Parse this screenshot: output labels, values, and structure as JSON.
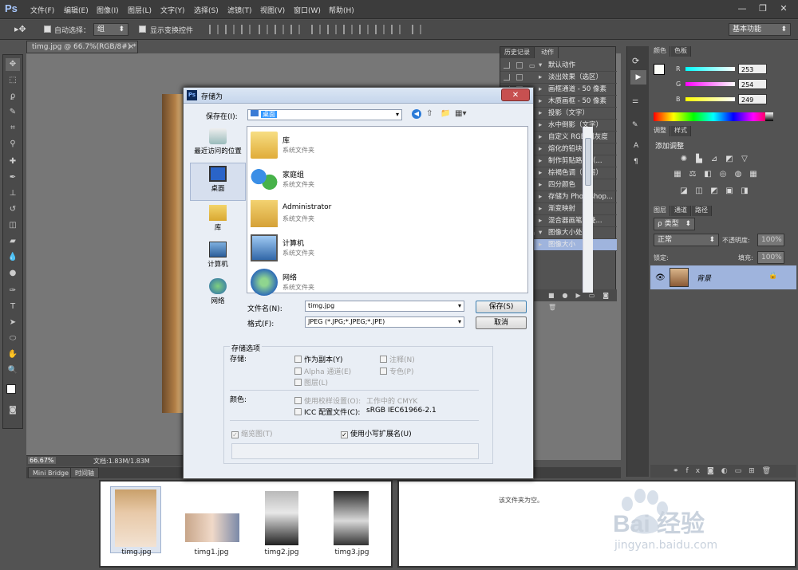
{
  "app": {
    "logo": "Ps"
  },
  "menus": [
    "文件(F)",
    "编辑(E)",
    "图像(I)",
    "图层(L)",
    "文字(Y)",
    "选择(S)",
    "滤镜(T)",
    "视图(V)",
    "窗口(W)",
    "帮助(H)"
  ],
  "options": {
    "auto_select_label": "自动选择：",
    "auto_select_value": "组",
    "show_transform_label": "显示变换控件",
    "workspace": "基本功能"
  },
  "document": {
    "tab_title": "timg.jpg @ 66.7%(RGB/8#) *",
    "zoom": "66.67%",
    "doc_size": "文档:1.83M/1.83M",
    "bottom_tabs": [
      "Mini Bridge",
      "时间轴"
    ]
  },
  "history_panel": {
    "tabs": [
      "历史记录",
      "动作"
    ],
    "actions": [
      {
        "label": "默认动作",
        "level": 0
      },
      {
        "label": "淡出效果（选区）",
        "level": 1
      },
      {
        "label": "画框通道 - 50 像素",
        "level": 1
      },
      {
        "label": "木质画框 - 50 像素",
        "level": 1
      },
      {
        "label": "投影（文字）",
        "level": 1
      },
      {
        "label": "水中倒影（文字）",
        "level": 1
      },
      {
        "label": "自定义 RGB 到灰度",
        "level": 1
      },
      {
        "label": "熔化的铅块",
        "level": 1
      },
      {
        "label": "制作剪贴路径（...",
        "level": 1
      },
      {
        "label": "棕褐色调（图层）",
        "level": 1
      },
      {
        "label": "四分颜色",
        "level": 1
      },
      {
        "label": "存储为 Photoshop...",
        "level": 1
      },
      {
        "label": "渐变映射",
        "level": 1
      },
      {
        "label": "混合器画笔克隆...",
        "level": 1
      },
      {
        "label": "图像大小处理",
        "level": 0
      },
      {
        "label": "图像大小",
        "level": 1
      }
    ]
  },
  "color_panel": {
    "tabs": [
      "颜色",
      "色板"
    ],
    "channels": [
      {
        "name": "R",
        "value": "253"
      },
      {
        "name": "G",
        "value": "254"
      },
      {
        "name": "B",
        "value": "249"
      }
    ]
  },
  "adjust_panel": {
    "tabs": [
      "调整",
      "样式"
    ],
    "title": "添加调整"
  },
  "layers_panel": {
    "tabs": [
      "图层",
      "通道",
      "路径"
    ],
    "kind": "类型",
    "blend": "正常",
    "opacity_label": "不透明度:",
    "opacity": "100%",
    "lock_label": "锁定:",
    "fill_label": "填充:",
    "fill": "100%",
    "layer_name": "背景"
  },
  "dialog": {
    "title": "存储为",
    "save_in_label": "保存在(I):",
    "save_in_value": "桌面",
    "places": [
      "最近访问的位置",
      "桌面",
      "库",
      "计算机",
      "网络"
    ],
    "files": [
      {
        "name": "库",
        "type": "系统文件夹"
      },
      {
        "name": "家庭组",
        "type": "系统文件夹"
      },
      {
        "name": "Administrator",
        "type": "系统文件夹"
      },
      {
        "name": "计算机",
        "type": "系统文件夹"
      },
      {
        "name": "网络",
        "type": "系统文件夹"
      }
    ],
    "filename_label": "文件名(N):",
    "filename": "timg.jpg",
    "format_label": "格式(F):",
    "format": "JPEG (*.JPG;*.JPEG;*.JPE)",
    "save_button": "保存(S)",
    "cancel_button": "取消",
    "options_group": "存储选项",
    "store_label": "存储:",
    "opt_copy": "作为副本(Y)",
    "opt_notes": "注释(N)",
    "opt_alpha": "Alpha 通道(E)",
    "opt_spot": "专色(P)",
    "opt_layers": "图层(L)",
    "color_label": "颜色:",
    "opt_proof": "使用校样设置(O):",
    "opt_proof_val": "工作中的 CMYK",
    "opt_icc": "ICC 配置文件(C):",
    "opt_icc_val": "sRGB IEC61966-2.1",
    "opt_thumb": "缩览图(T)",
    "opt_lower_ext": "使用小写扩展名(U)"
  },
  "filmstrip": {
    "items": [
      "timg.jpg",
      "timg1.jpg",
      "timg2.jpg",
      "timg3.jpg"
    ],
    "empty_text": "该文件夹为空。"
  },
  "watermark": {
    "brand": "Bai 经验",
    "url": "jingyan.baidu.com"
  }
}
